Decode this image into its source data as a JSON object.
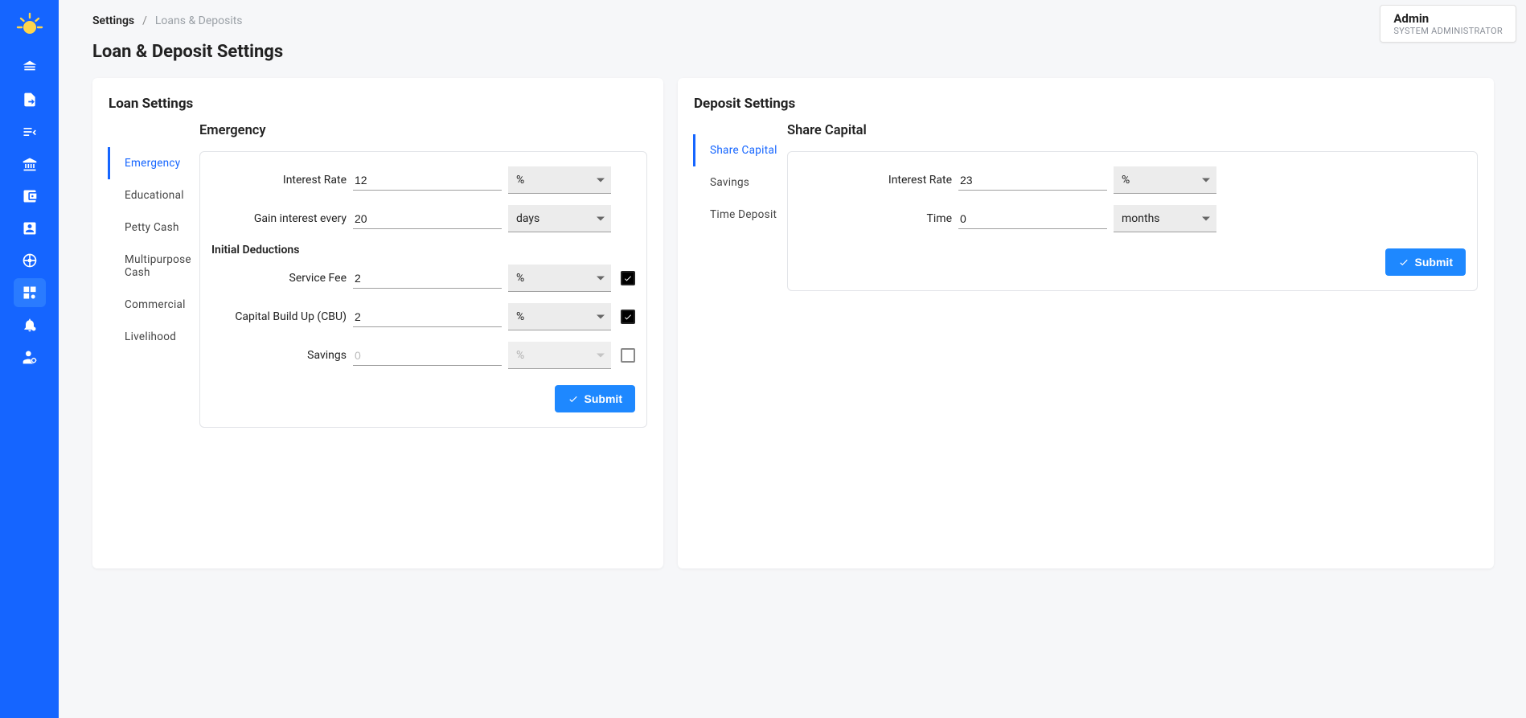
{
  "breadcrumb": {
    "root": "Settings",
    "current": "Loans & Deposits"
  },
  "pageTitle": "Loan & Deposit Settings",
  "user": {
    "name": "Admin",
    "role": "SYSTEM ADMINISTRATOR"
  },
  "loan": {
    "title": "Loan Settings",
    "tabs": [
      "Emergency",
      "Educational",
      "Petty Cash",
      "Multipurpose Cash",
      "Commercial",
      "Livelihood"
    ],
    "activeTab": "Emergency",
    "sectionTitle": "Emergency",
    "initialDeductionsTitle": "Initial Deductions",
    "fields": {
      "interestRate": {
        "label": "Interest Rate",
        "value": "12",
        "unit": "%"
      },
      "gainInterest": {
        "label": "Gain interest every",
        "value": "20",
        "unit": "days"
      },
      "serviceFee": {
        "label": "Service Fee",
        "value": "2",
        "unit": "%",
        "checked": true
      },
      "cbu": {
        "label": "Capital Build Up (CBU)",
        "value": "2",
        "unit": "%",
        "checked": true
      },
      "savings": {
        "label": "Savings",
        "placeholder": "0",
        "unit": "%",
        "checked": false
      }
    },
    "submit": "Submit"
  },
  "deposit": {
    "title": "Deposit Settings",
    "tabs": [
      "Share Capital",
      "Savings",
      "Time Deposit"
    ],
    "activeTab": "Share Capital",
    "sectionTitle": "Share Capital",
    "fields": {
      "interestRate": {
        "label": "Interest Rate",
        "value": "23",
        "unit": "%"
      },
      "time": {
        "label": "Time",
        "value": "0",
        "unit": "months"
      }
    },
    "submit": "Submit"
  }
}
